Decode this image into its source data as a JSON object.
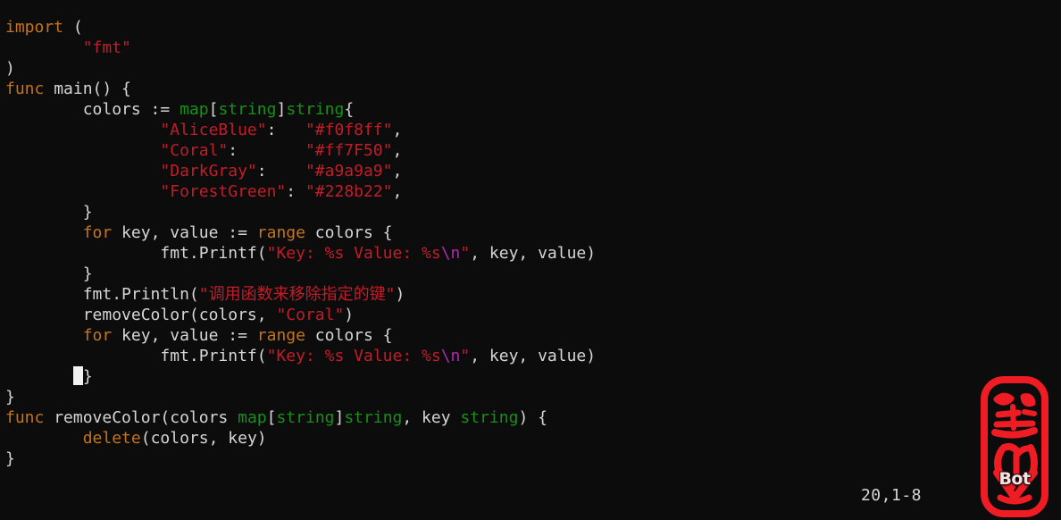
{
  "editor": {
    "background_color": "#0d0c0c",
    "foreground_color": "#d6d6d6",
    "font_size_px": 18,
    "line_height_px": 23,
    "language": "Go"
  },
  "palette": {
    "keyword": "#c4741a",
    "type": "#189018",
    "string": "#c21d28",
    "escape": "#b02ab0",
    "plain": "#d6d6d6",
    "cursor": "#f2f2f2",
    "stamp_red": "#ef1c24"
  },
  "status": {
    "ruler": "20,1-8"
  },
  "watermark": {
    "label": "Bot",
    "color": "#ef1c24",
    "label_color": "#e8e8e8"
  },
  "code": {
    "lines": [
      {
        "n": 1,
        "indent": 0,
        "tokens": [
          {
            "t": "import",
            "c": "kw"
          },
          {
            "t": " (",
            "c": "punct"
          }
        ]
      },
      {
        "n": 2,
        "indent": 0,
        "tokens": [
          {
            "t": "        ",
            "c": "plain"
          },
          {
            "t": "\"fmt\"",
            "c": "str"
          }
        ]
      },
      {
        "n": 3,
        "indent": 0,
        "tokens": [
          {
            "t": ")",
            "c": "punct"
          }
        ]
      },
      {
        "n": 4,
        "indent": 0,
        "tokens": [
          {
            "t": "func",
            "c": "kw"
          },
          {
            "t": " main() {",
            "c": "plain"
          }
        ]
      },
      {
        "n": 5,
        "indent": 0,
        "tokens": [
          {
            "t": "        colors := ",
            "c": "plain"
          },
          {
            "t": "map",
            "c": "type"
          },
          {
            "t": "[",
            "c": "punct"
          },
          {
            "t": "string",
            "c": "type"
          },
          {
            "t": "]",
            "c": "punct"
          },
          {
            "t": "string",
            "c": "type"
          },
          {
            "t": "{",
            "c": "punct"
          }
        ]
      },
      {
        "n": 6,
        "indent": 0,
        "tokens": [
          {
            "t": "                ",
            "c": "plain"
          },
          {
            "t": "\"AliceBlue\"",
            "c": "str"
          },
          {
            "t": ":   ",
            "c": "plain"
          },
          {
            "t": "\"#f0f8ff\"",
            "c": "str"
          },
          {
            "t": ",",
            "c": "plain"
          }
        ]
      },
      {
        "n": 7,
        "indent": 0,
        "tokens": [
          {
            "t": "                ",
            "c": "plain"
          },
          {
            "t": "\"Coral\"",
            "c": "str"
          },
          {
            "t": ":       ",
            "c": "plain"
          },
          {
            "t": "\"#ff7F50\"",
            "c": "str"
          },
          {
            "t": ",",
            "c": "plain"
          }
        ]
      },
      {
        "n": 8,
        "indent": 0,
        "tokens": [
          {
            "t": "                ",
            "c": "plain"
          },
          {
            "t": "\"DarkGray\"",
            "c": "str"
          },
          {
            "t": ":    ",
            "c": "plain"
          },
          {
            "t": "\"#a9a9a9\"",
            "c": "str"
          },
          {
            "t": ",",
            "c": "plain"
          }
        ]
      },
      {
        "n": 9,
        "indent": 0,
        "tokens": [
          {
            "t": "                ",
            "c": "plain"
          },
          {
            "t": "\"ForestGreen\"",
            "c": "str"
          },
          {
            "t": ": ",
            "c": "plain"
          },
          {
            "t": "\"#228b22\"",
            "c": "str"
          },
          {
            "t": ",",
            "c": "plain"
          }
        ]
      },
      {
        "n": 10,
        "indent": 0,
        "tokens": [
          {
            "t": "        }",
            "c": "plain"
          }
        ]
      },
      {
        "n": 11,
        "indent": 0,
        "tokens": [
          {
            "t": "        ",
            "c": "plain"
          },
          {
            "t": "for",
            "c": "kw"
          },
          {
            "t": " key, value := ",
            "c": "plain"
          },
          {
            "t": "range",
            "c": "kw"
          },
          {
            "t": " colors {",
            "c": "plain"
          }
        ]
      },
      {
        "n": 12,
        "indent": 0,
        "tokens": [
          {
            "t": "                fmt.Printf(",
            "c": "plain"
          },
          {
            "t": "\"Key: %s Value: %s",
            "c": "str"
          },
          {
            "t": "\\n",
            "c": "esc"
          },
          {
            "t": "\"",
            "c": "str"
          },
          {
            "t": ", key, value)",
            "c": "plain"
          }
        ]
      },
      {
        "n": 13,
        "indent": 0,
        "tokens": [
          {
            "t": "        }",
            "c": "plain"
          }
        ]
      },
      {
        "n": 14,
        "indent": 0,
        "tokens": [
          {
            "t": "        fmt.Println(",
            "c": "plain"
          },
          {
            "t": "\"调用函数来移除指定的键\"",
            "c": "str"
          },
          {
            "t": ")",
            "c": "plain"
          }
        ]
      },
      {
        "n": 15,
        "indent": 0,
        "tokens": [
          {
            "t": "        removeColor(colors, ",
            "c": "plain"
          },
          {
            "t": "\"Coral\"",
            "c": "str"
          },
          {
            "t": ")",
            "c": "plain"
          }
        ]
      },
      {
        "n": 16,
        "indent": 0,
        "tokens": [
          {
            "t": "        ",
            "c": "plain"
          },
          {
            "t": "for",
            "c": "kw"
          },
          {
            "t": " key, value := ",
            "c": "plain"
          },
          {
            "t": "range",
            "c": "kw"
          },
          {
            "t": " colors {",
            "c": "plain"
          }
        ]
      },
      {
        "n": 17,
        "indent": 0,
        "tokens": [
          {
            "t": "                fmt.Printf(",
            "c": "plain"
          },
          {
            "t": "\"Key: %s Value: %s",
            "c": "str"
          },
          {
            "t": "\\n",
            "c": "esc"
          },
          {
            "t": "\"",
            "c": "str"
          },
          {
            "t": ", key, value)",
            "c": "plain"
          }
        ]
      },
      {
        "n": 18,
        "indent": 0,
        "cursor_at": 7,
        "tokens": [
          {
            "t": "       ",
            "c": "plain"
          },
          {
            "t": "CURSOR",
            "c": "cursor"
          },
          {
            "t": "}",
            "c": "plain"
          }
        ]
      },
      {
        "n": 19,
        "indent": 0,
        "tokens": [
          {
            "t": "}",
            "c": "plain"
          }
        ]
      },
      {
        "n": 20,
        "indent": 0,
        "tokens": [
          {
            "t": "func",
            "c": "kw"
          },
          {
            "t": " removeColor(colors ",
            "c": "plain"
          },
          {
            "t": "map",
            "c": "type"
          },
          {
            "t": "[",
            "c": "punct"
          },
          {
            "t": "string",
            "c": "type"
          },
          {
            "t": "]",
            "c": "punct"
          },
          {
            "t": "string",
            "c": "type"
          },
          {
            "t": ", key ",
            "c": "plain"
          },
          {
            "t": "string",
            "c": "type"
          },
          {
            "t": ") {",
            "c": "plain"
          }
        ]
      },
      {
        "n": 21,
        "indent": 0,
        "tokens": [
          {
            "t": "        ",
            "c": "plain"
          },
          {
            "t": "delete",
            "c": "kw"
          },
          {
            "t": "(colors, key)",
            "c": "plain"
          }
        ]
      },
      {
        "n": 22,
        "indent": 0,
        "tokens": [
          {
            "t": "}",
            "c": "plain"
          }
        ]
      }
    ]
  }
}
